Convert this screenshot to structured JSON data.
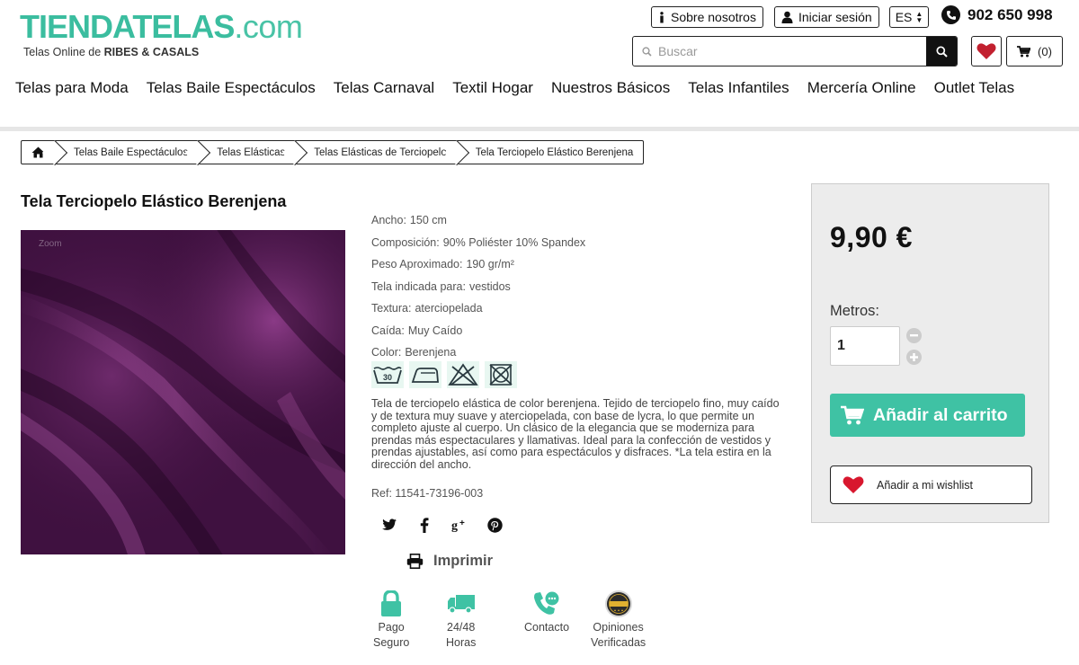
{
  "header": {
    "logo_main": "TIENDATELAS",
    "logo_domain": ".com",
    "logo_sub_prefix": "Telas Online de ",
    "logo_sub_brand": "RIBES & CASALS",
    "about_label": "Sobre nosotros",
    "login_label": "Iniciar sesión",
    "language": "ES",
    "phone": "902 650 998",
    "search_placeholder": "Buscar",
    "cart_count": "(0)",
    "icons": [
      "info-icon",
      "user-icon",
      "phone-icon",
      "search-icon",
      "heart-icon",
      "cart-icon"
    ]
  },
  "nav": [
    "Telas para Moda",
    "Telas Baile Espectáculos",
    "Telas Carnaval",
    "Textil Hogar",
    "Nuestros Básicos",
    "Telas Infantiles",
    "Mercería Online",
    "Outlet Telas"
  ],
  "breadcrumb": [
    "Telas Baile Espectáculos",
    "Telas Elásticas",
    "Telas Elásticas de Terciopelo",
    "Tela Terciopelo Elástico Berenjena"
  ],
  "product": {
    "title": "Tela Terciopelo Elástico Berenjena",
    "zoom_label": "Zoom",
    "specs": [
      {
        "label": "Ancho:",
        "value": "150 cm"
      },
      {
        "label": "Composición:",
        "value": "90% Poliéster  10% Spandex"
      },
      {
        "label": "Peso Aproximado:",
        "value": "190 gr/m²"
      },
      {
        "label": "Tela indicada para:",
        "value": "vestidos"
      },
      {
        "label": "Textura:",
        "value": "aterciopelada"
      },
      {
        "label": "Caída:",
        "value": "Muy Caído"
      },
      {
        "label": "Color:",
        "value": "Berenjena"
      }
    ],
    "care_wash_temp": "30",
    "description": "Tela de terciopelo elástica de color berenjena. Tejido de terciopelo fino, muy caído y de textura muy suave y aterciopelada, con base de lycra, lo que permite un completo ajuste al cuerpo. Un clásico de la elegancia que se moderniza para prendas más espectaculares y llamativas. Ideal para la confección de vestidos y prendas ajustables, así como para espectáculos y disfraces. *La tela estira en la dirección del ancho.",
    "ref": "Ref: 11541-73196-003",
    "print_label": "Imprimir",
    "badges": [
      {
        "line1": "Pago Seguro",
        "line2": ""
      },
      {
        "line1": "24/48 Horas",
        "line2": ""
      },
      {
        "line1": "Contacto",
        "line2": ""
      },
      {
        "line1": "Opiniones",
        "line2": "Verificadas"
      }
    ],
    "fabric_color": "#4a1448"
  },
  "buybox": {
    "price": "9,90 €",
    "quantity_label": "Metros:",
    "quantity_value": "1",
    "add_to_cart": "Añadir al carrito",
    "wishlist": "Añadir a mi wishlist",
    "accent_color": "#3fc2a4"
  }
}
